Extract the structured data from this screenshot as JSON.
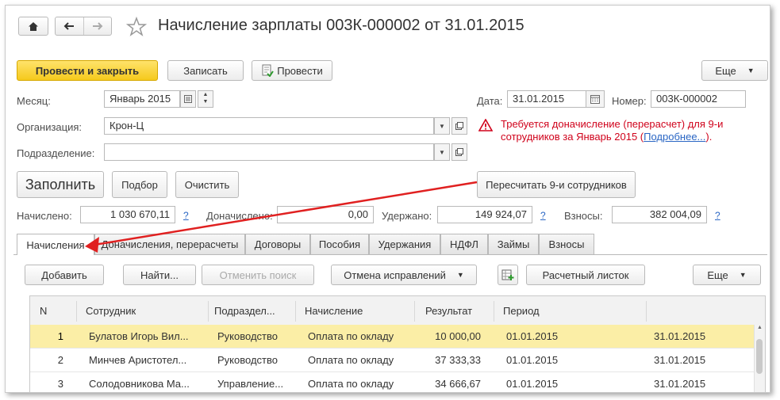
{
  "window": {
    "title": "Начисление зарплаты 003К-000002 от 31.01.2015"
  },
  "toolbar": {
    "post_close": "Провести и закрыть",
    "save": "Записать",
    "post": "Провести",
    "more": "Еще"
  },
  "form": {
    "month_label": "Месяц:",
    "month_value": "Январь 2015",
    "org_label": "Организация:",
    "org_value": "Крон-Ц",
    "dept_label": "Подразделение:",
    "dept_value": "",
    "date_label": "Дата:",
    "date_value": "31.01.2015",
    "number_label": "Номер:",
    "number_value": "003К-000002",
    "warning_text_1": "Требуется доначисление (перерасчет) для 9-и",
    "warning_text_2": "сотрудников за Январь 2015 (",
    "warning_link": "Подробнее...",
    "warning_text_3": ")."
  },
  "actions": {
    "fill": "Заполнить",
    "pick": "Подбор",
    "clear": "Очистить",
    "recalc": "Пересчитать 9-и сотрудников"
  },
  "totals": {
    "accrued_label": "Начислено:",
    "accrued_value": "1 030 670,11",
    "extra_label": "Доначислено:",
    "extra_value": "0,00",
    "withheld_label": "Удержано:",
    "withheld_value": "149 924,07",
    "contrib_label": "Взносы:",
    "contrib_value": "382 004,09",
    "q": "?"
  },
  "tabs": [
    "Начисления",
    "Доначисления, перерасчеты",
    "Договоры",
    "Пособия",
    "Удержания",
    "НДФЛ",
    "Займы",
    "Взносы"
  ],
  "table_toolbar": {
    "add": "Добавить",
    "find": "Найти...",
    "cancel_search": "Отменить поиск",
    "cancel_corrections": "Отмена исправлений",
    "payslip": "Расчетный листок",
    "more": "Еще"
  },
  "table": {
    "columns": [
      "N",
      "Сотрудник",
      "Подраздел...",
      "Начисление",
      "Результат",
      "Период",
      ""
    ],
    "rows": [
      [
        "1",
        "Булатов Игорь Вил...",
        "Руководство",
        "Оплата по окладу",
        "10 000,00",
        "01.01.2015",
        "31.01.2015"
      ],
      [
        "2",
        "Минчев Аристотел...",
        "Руководство",
        "Оплата по окладу",
        "37 333,33",
        "01.01.2015",
        "31.01.2015"
      ],
      [
        "3",
        "Солодовникова Ма...",
        "Управление...",
        "Оплата по окладу",
        "34 666,67",
        "01.01.2015",
        "31.01.2015"
      ]
    ]
  },
  "colors": {
    "primary_button": "#f5c91c",
    "selected_row": "#fbeea6",
    "warning": "#d0021b",
    "arrow": "#e02020",
    "link": "#2a66c4"
  }
}
